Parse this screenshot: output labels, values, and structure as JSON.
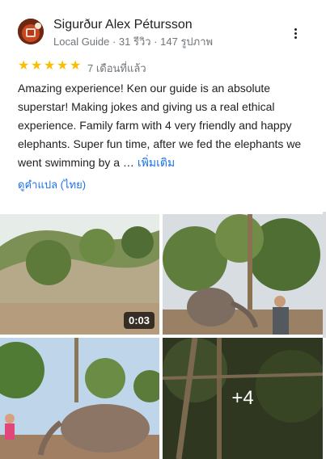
{
  "reviewer": {
    "name": "Sigurður Alex Pétursson",
    "meta": "Local Guide · 31 รีวิว · 147 รูปภาพ"
  },
  "rating": {
    "stars": 5,
    "date": "7 เดือนที่แล้ว"
  },
  "review": {
    "text": "Amazing experience! Ken our guide is an absolute superstar! Making jokes and giving us a real ethical experience. Family farm with 4 very friendly and happy elephants. Super fun time, after we fed the elephants we went swimming by a …",
    "more_label": "เพิ่มเติม"
  },
  "translate_label": "ดูคำแปล (ไทย)",
  "photos": {
    "video_duration": "0:03",
    "more_count": "+4"
  },
  "colors": {
    "star": "#fbbc04",
    "link": "#1a73e8"
  }
}
